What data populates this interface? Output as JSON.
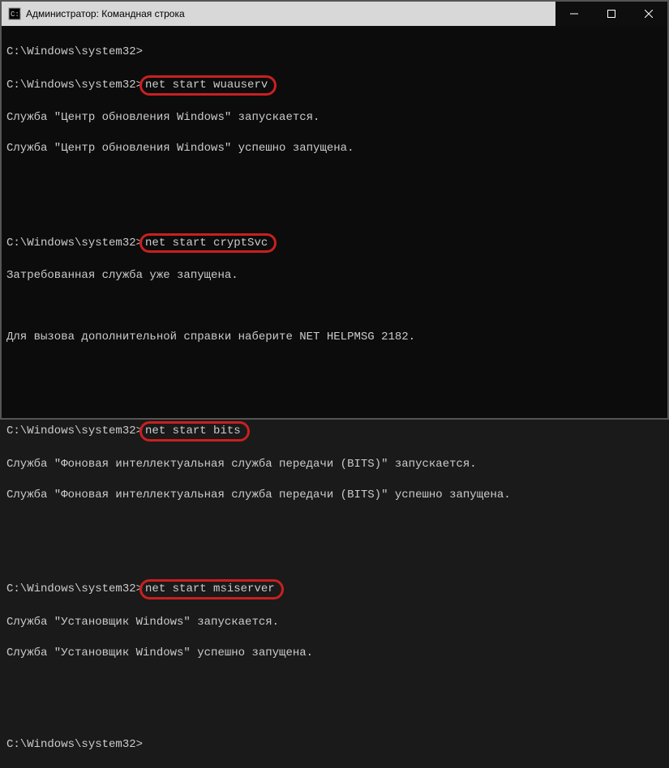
{
  "titlebar": {
    "title": "Администратор: Командная строка"
  },
  "prompt": "C:\\Windows\\system32>",
  "commands": {
    "cmd1": "net start wuauserv",
    "cmd2": "net start cryptSvc",
    "cmd3": "net start bits",
    "cmd4": "net start msiserver"
  },
  "output": {
    "l1": "Служба \"Центр обновления Windows\" запускается.",
    "l2": "Служба \"Центр обновления Windows\" успешно запущена.",
    "l3": "Затребованная служба уже запущена.",
    "l4": "Для вызова дополнительной справки наберите NET HELPMSG 2182.",
    "l5": "Служба \"Фоновая интеллектуальная служба передачи (BITS)\" запускается.",
    "l6": "Служба \"Фоновая интеллектуальная служба передачи (BITS)\" успешно запущена.",
    "l7": "Служба \"Установщик Windows\" запускается.",
    "l8": "Служба \"Установщик Windows\" успешно запущена."
  }
}
